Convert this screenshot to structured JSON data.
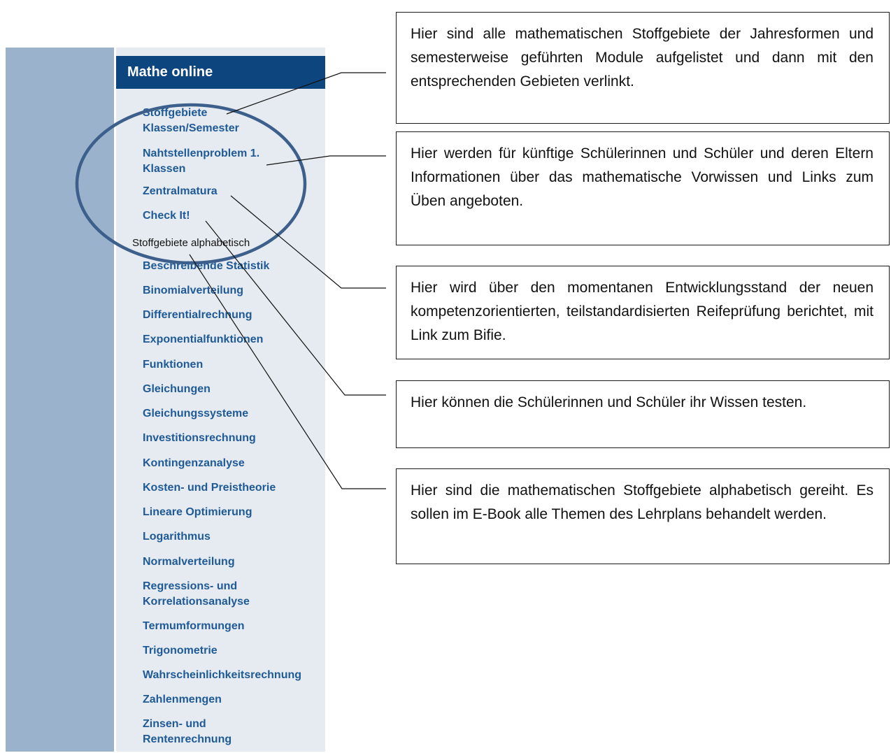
{
  "menu": {
    "header": "Mathe online",
    "top_items": [
      [
        "Stoffgebiete",
        "Klassen/Semester"
      ],
      [
        "Nahtstellenproblem 1.",
        "Klassen"
      ],
      [
        "Zentralmatura"
      ],
      [
        "Check It!"
      ]
    ],
    "section_label": "Stoffgebiete alphabetisch",
    "alpha_items": [
      [
        "Beschreibende Statistik"
      ],
      [
        "Binomialverteilung"
      ],
      [
        "Differentialrechnung"
      ],
      [
        "Exponentialfunktionen"
      ],
      [
        "Funktionen"
      ],
      [
        "Gleichungen"
      ],
      [
        "Gleichungssysteme"
      ],
      [
        "Investitionsrechnung"
      ],
      [
        "Kontingenzanalyse"
      ],
      [
        "Kosten- und Preistheorie"
      ],
      [
        "Lineare Optimierung"
      ],
      [
        "Logarithmus"
      ],
      [
        "Normalverteilung"
      ],
      [
        "Regressions- und",
        "Korrelationsanalyse"
      ],
      [
        "Termumformungen"
      ],
      [
        "Trigonometrie"
      ],
      [
        "Wahrscheinlichkeitsrechnung"
      ],
      [
        "Zahlenmengen"
      ],
      [
        "Zinsen- und",
        "Rentenrechnung"
      ]
    ]
  },
  "callouts": [
    "Hier sind alle mathematischen Stoffgebiete der Jahresformen und semesterweise geführten Module aufgelistet und dann mit den entsprechenden Gebieten verlinkt.",
    "Hier werden für künftige Schülerinnen und Schüler und deren Eltern Informationen über das mathematische Vorwissen und Links zum Üben angeboten.",
    "Hier wird über den momentanen Entwicklungsstand der neuen kompetenzorientierten, teilstandardisierten Reifeprüfung berichtet, mit Link zum Bifie.",
    "Hier können die Schülerinnen und Schüler ihr Wissen testen.",
    "Hier sind die mathematischen Stoffgebiete alphabetisch gereiht. Es sollen im E-Book alle Themen des Lehrplans behandelt werden."
  ],
  "colors": {
    "header_bg": "#0d467e",
    "link": "#1f5a96",
    "left_band": "#9bb2cc",
    "panel_bg": "#e5ebf0",
    "ellipse": "#3d5f8c"
  }
}
